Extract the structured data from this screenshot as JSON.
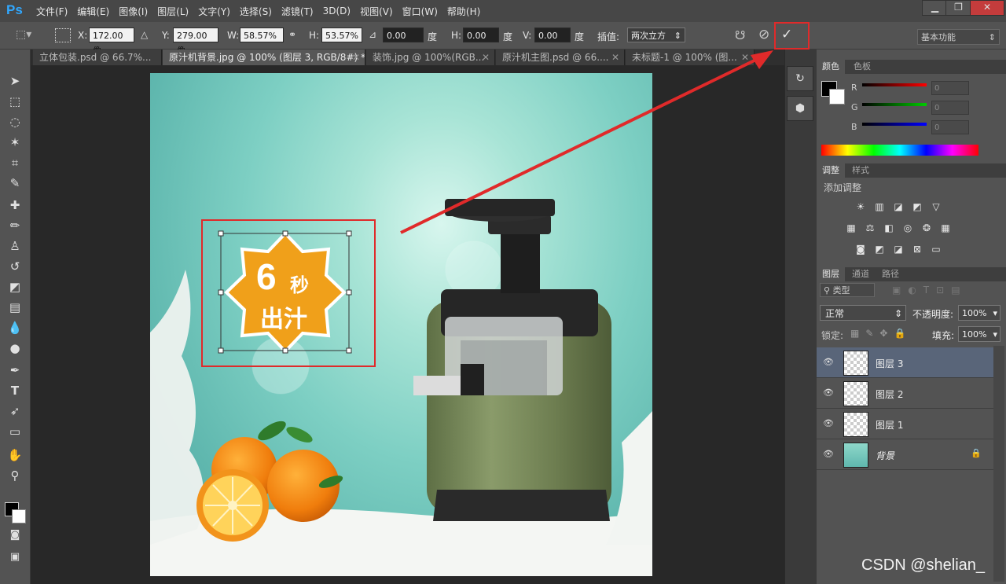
{
  "app": {
    "logo": "Ps"
  },
  "menu": [
    "文件(F)",
    "编辑(E)",
    "图像(I)",
    "图层(L)",
    "文字(Y)",
    "选择(S)",
    "滤镜(T)",
    "3D(D)",
    "视图(V)",
    "窗口(W)",
    "帮助(H)"
  ],
  "window_buttons": {
    "minimize": "▁",
    "restore": "❐",
    "close": "✕"
  },
  "options": {
    "x_label": "X:",
    "x_value": "172.00 像",
    "y_label": "Y:",
    "y_value": "279.00 像",
    "w_label": "W:",
    "w_value": "58.57%",
    "h_label": "H:",
    "h_value": "53.57%",
    "angle_value": "0.00",
    "angle_unit": "度",
    "hskew_label": "H:",
    "hskew_value": "0.00",
    "hskew_unit": "度",
    "vskew_label": "V:",
    "vskew_value": "0.00",
    "vskew_unit": "度",
    "interp_label": "插值:",
    "interp_value": "两次立方",
    "workspace": "基本功能"
  },
  "tabs": [
    {
      "label": "立体包装.psd @ 66.7%..."
    },
    {
      "label": "原汁机背景.jpg @ 100% (图层 3, RGB/8#) *"
    },
    {
      "label": "装饰.jpg @ 100%(RGB..."
    },
    {
      "label": "原汁机主图.psd @ 66...."
    },
    {
      "label": "未标题-1 @ 100% (图..."
    }
  ],
  "canvas": {
    "badge_big": "6",
    "badge_small": "秒",
    "badge_line2": "出汁"
  },
  "color_panel": {
    "tabs": [
      "颜色",
      "色板"
    ],
    "channels": [
      {
        "label": "R",
        "value": "0"
      },
      {
        "label": "G",
        "value": "0"
      },
      {
        "label": "B",
        "value": "0"
      }
    ]
  },
  "adjust_panel": {
    "tabs": [
      "调整",
      "样式"
    ],
    "title": "添加调整"
  },
  "layers_panel": {
    "tabs": [
      "图层",
      "通道",
      "路径"
    ],
    "filter": "类型",
    "blend_mode": "正常",
    "opacity_label": "不透明度:",
    "opacity_value": "100%",
    "lock_label": "锁定:",
    "fill_label": "填充:",
    "fill_value": "100%",
    "layers": [
      {
        "name": "图层 3",
        "selected": true
      },
      {
        "name": "图层 2",
        "selected": false
      },
      {
        "name": "图层 1",
        "selected": false
      },
      {
        "name": "背景",
        "selected": false
      }
    ]
  },
  "watermark": "CSDN @shelian_"
}
